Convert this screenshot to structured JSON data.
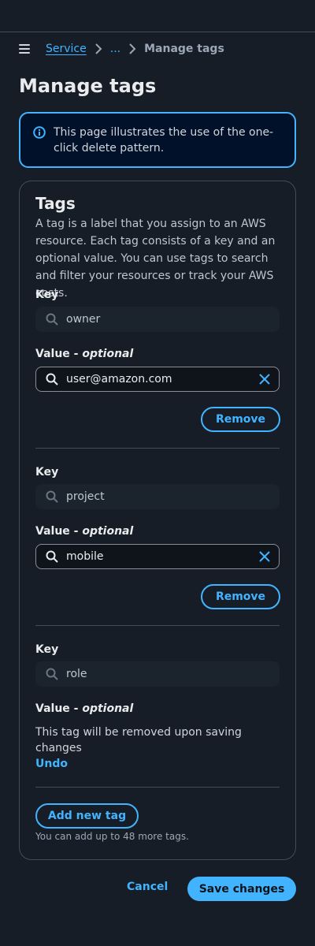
{
  "breadcrumb": {
    "items": [
      "Service",
      "..."
    ],
    "current": "Manage tags"
  },
  "page_title": "Manage tags",
  "info_alert": {
    "text": "This page illustrates the use of the one-click delete pattern."
  },
  "tags_panel": {
    "title": "Tags",
    "description": "A tag is a label that you assign to an AWS resource. Each tag consists of a key and an optional value. You can use tags to search and filter your resources or track your AWS costs.",
    "key_label": "Key",
    "value_label_prefix": "Value - ",
    "value_label_optional": "optional",
    "tags": [
      {
        "key": "owner",
        "value": "user@amazon.com",
        "remove_label": "Remove"
      },
      {
        "key": "project",
        "value": "mobile",
        "remove_label": "Remove"
      },
      {
        "key": "role"
      }
    ],
    "removed_note": "This tag will be removed upon saving changes",
    "undo_label": "Undo",
    "add_label": "Add new tag",
    "limit_note": "You can add up to 48 more tags."
  },
  "footer": {
    "cancel_label": "Cancel",
    "save_label": "Save changes"
  },
  "colors": {
    "accent": "#42b4ff",
    "background": "#161d26",
    "alert_background": "#001129"
  },
  "icons": [
    "menu-icon",
    "chevron-right-icon",
    "info-icon",
    "search-icon",
    "clear-icon"
  ]
}
